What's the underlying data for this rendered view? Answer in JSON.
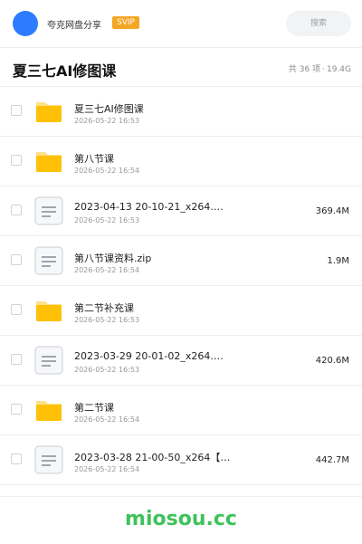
{
  "header": {
    "app_name": "夸克网盘分享",
    "badge": "SVIP",
    "search_label": "搜索"
  },
  "folder": {
    "title": "夏三七AI修图课",
    "count": "共 36 项",
    "separator": "·",
    "total_size": "19.4G"
  },
  "files": [
    {
      "type": "folder",
      "name": "夏三七AI修图课",
      "date": "2026-05-22 16:53",
      "size": ""
    },
    {
      "type": "folder",
      "name": "第八节课",
      "date": "2026-05-22 16:54",
      "size": ""
    },
    {
      "type": "file",
      "name": "2023-04-13 20-10-21_x264.…",
      "date": "2026-05-22 16:53",
      "size": "369.4M"
    },
    {
      "type": "file",
      "name": "第八节课资料.zip",
      "date": "2026-05-22 16:54",
      "size": "1.9M"
    },
    {
      "type": "folder",
      "name": "第二节补充课",
      "date": "2026-05-22 16:53",
      "size": ""
    },
    {
      "type": "file",
      "name": "2023-03-29 20-01-02_x264.…",
      "date": "2026-05-22 16:53",
      "size": "420.6M"
    },
    {
      "type": "folder",
      "name": "第二节课",
      "date": "2026-05-22 16:54",
      "size": ""
    },
    {
      "type": "file",
      "name": "2023-03-28 21-00-50_x264【…",
      "date": "2026-05-22 16:54",
      "size": "442.7M"
    }
  ],
  "footer": {
    "watermark": "miosou.cc"
  },
  "colors": {
    "avatar": "#2b7cff",
    "badge": "#f5a623",
    "folder_body": "#ffc107",
    "folder_tab": "#ffe08a",
    "watermark": "#3fc25c",
    "doc_border": "#c9ced6",
    "doc_lines": "#8a919b"
  },
  "icons": {
    "folder": "folder-icon",
    "file": "document-icon"
  }
}
